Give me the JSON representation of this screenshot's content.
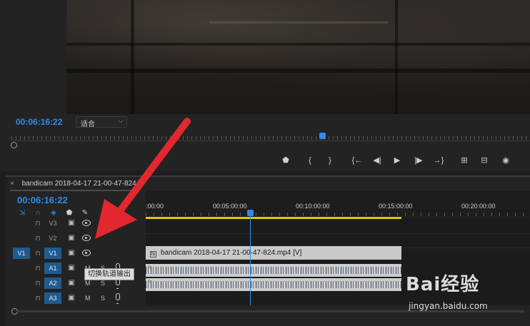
{
  "monitor": {
    "timecode": "00:06:16:22",
    "fit_value": "适合"
  },
  "transport": {
    "buttons": [
      {
        "name": "add-marker-button",
        "glyph": "⬟"
      },
      {
        "name": "mark-in-button",
        "glyph": "{"
      },
      {
        "name": "mark-out-button",
        "glyph": "}"
      },
      {
        "name": "go-to-in-button",
        "glyph": "{←"
      },
      {
        "name": "step-back-button",
        "glyph": "◀|"
      },
      {
        "name": "play-button",
        "glyph": "▶"
      },
      {
        "name": "step-forward-button",
        "glyph": "|▶"
      },
      {
        "name": "go-to-out-button",
        "glyph": "→}"
      },
      {
        "name": "lift-button",
        "glyph": "⊞"
      },
      {
        "name": "extract-button",
        "glyph": "⊟"
      },
      {
        "name": "export-frame-button",
        "glyph": "◉"
      }
    ]
  },
  "timeline": {
    "sequence_name": "bandicam 2018-04-17 21-00-47-824",
    "close_glyph": "×",
    "timecode": "00:06:16:22",
    "ruler_labels": [
      ":00:00",
      "00:05:00:00",
      "00:10:00:00",
      "00:15:00:00",
      "00:20:00:00"
    ],
    "tracks": [
      {
        "id": "V3",
        "src": "",
        "type": "video",
        "active": false
      },
      {
        "id": "V2",
        "src": "",
        "type": "video",
        "active": false
      },
      {
        "id": "V1",
        "src": "V1",
        "type": "video",
        "active": true
      },
      {
        "id": "A1",
        "src": "",
        "type": "audio",
        "active": true
      },
      {
        "id": "A2",
        "src": "",
        "type": "audio",
        "active": true
      },
      {
        "id": "A3",
        "src": "",
        "type": "audio",
        "active": true
      }
    ],
    "mute_label": "M",
    "solo_label": "S",
    "tooltip": "切换轨道输出",
    "clip_label": "bandicam 2018-04-17 21-00-47-824.mp4 [V]",
    "clip_badge": "fx",
    "audio_fx": "fx"
  },
  "watermark": {
    "brand": "Bai经验",
    "url": "jingyan.baidu.com"
  },
  "colors": {
    "accent": "#2d8ceb",
    "work_area": "#e6c300",
    "arrow": "#e0282e"
  }
}
